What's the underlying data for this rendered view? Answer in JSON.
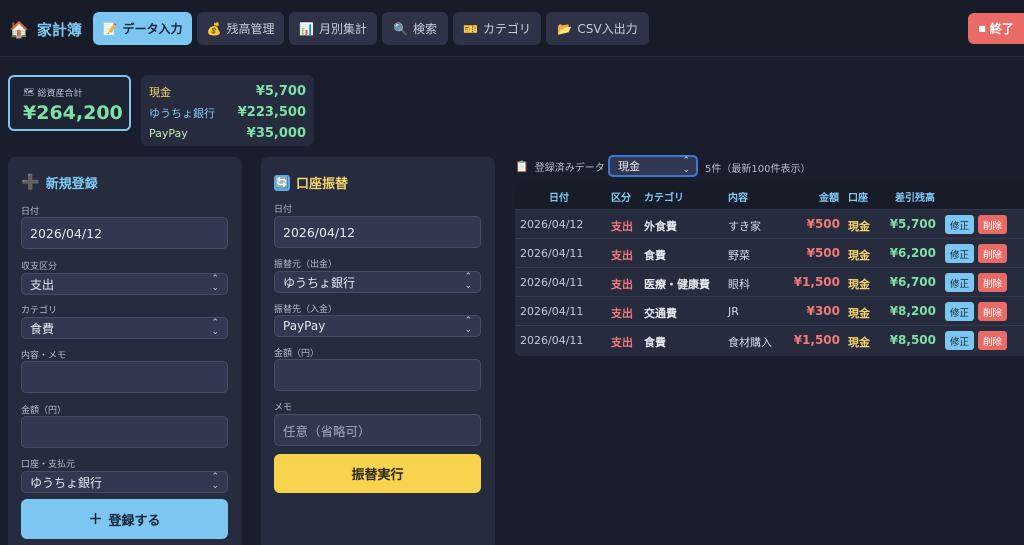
{
  "header": {
    "title": "家計簿",
    "tabs": [
      {
        "icon": "📝",
        "label": "データ入力"
      },
      {
        "icon": "💰",
        "label": "残高管理"
      },
      {
        "icon": "📊",
        "label": "月別集計"
      },
      {
        "icon": "🔍",
        "label": "検索"
      },
      {
        "icon": "🎫",
        "label": "カテゴリ"
      },
      {
        "icon": "📂",
        "label": "CSV入出力"
      }
    ],
    "exit_label": "終了"
  },
  "summary": {
    "total_label": "総資産合計",
    "total_value": "¥264,200",
    "accounts": [
      {
        "name": "現金",
        "value": "¥5,700"
      },
      {
        "name": "ゆうちょ銀行",
        "value": "¥223,500"
      },
      {
        "name": "PayPay",
        "value": "¥35,000"
      }
    ]
  },
  "new_entry": {
    "title": "新規登録",
    "date_label": "日付",
    "date_value": "2026/04/12",
    "type_label": "収支区分",
    "type_value": "支出",
    "category_label": "カテゴリ",
    "category_value": "食費",
    "memo_label": "内容・メモ",
    "memo_value": "",
    "amount_label": "金額（円）",
    "amount_value": "",
    "account_label": "口座・支払元",
    "account_value": "ゆうちょ銀行",
    "submit_label": "登録する"
  },
  "transfer": {
    "title": "口座振替",
    "date_label": "日付",
    "date_value": "2026/04/12",
    "from_label": "振替元（出金）",
    "from_value": "ゆうちょ銀行",
    "to_label": "振替先（入金）",
    "to_value": "PayPay",
    "amount_label": "金額（円）",
    "amount_value": "",
    "memo_label": "メモ",
    "memo_placeholder": "任意（省略可）",
    "submit_label": "振替実行"
  },
  "records": {
    "heading": "登録済みデータ",
    "filter_value": "現金",
    "count_text": "5件（最新100件表示）",
    "columns": [
      "日付",
      "区分",
      "カテゴリ",
      "内容",
      "金額",
      "口座",
      "差引残高"
    ],
    "edit_label": "修正",
    "delete_label": "削除",
    "rows": [
      {
        "date": "2026/04/12",
        "type": "支出",
        "category": "外食費",
        "memo": "すき家",
        "amount": "¥500",
        "account": "現金",
        "balance": "¥5,700"
      },
      {
        "date": "2026/04/11",
        "type": "支出",
        "category": "食費",
        "memo": "野菜",
        "amount": "¥500",
        "account": "現金",
        "balance": "¥6,200"
      },
      {
        "date": "2026/04/11",
        "type": "支出",
        "category": "医療・健康費",
        "memo": "眼科",
        "amount": "¥1,500",
        "account": "現金",
        "balance": "¥6,700"
      },
      {
        "date": "2026/04/11",
        "type": "支出",
        "category": "交通費",
        "memo": "JR",
        "amount": "¥300",
        "account": "現金",
        "balance": "¥8,200"
      },
      {
        "date": "2026/04/11",
        "type": "支出",
        "category": "食費",
        "memo": "食材購入",
        "amount": "¥1,500",
        "account": "現金",
        "balance": "¥8,500"
      }
    ]
  }
}
